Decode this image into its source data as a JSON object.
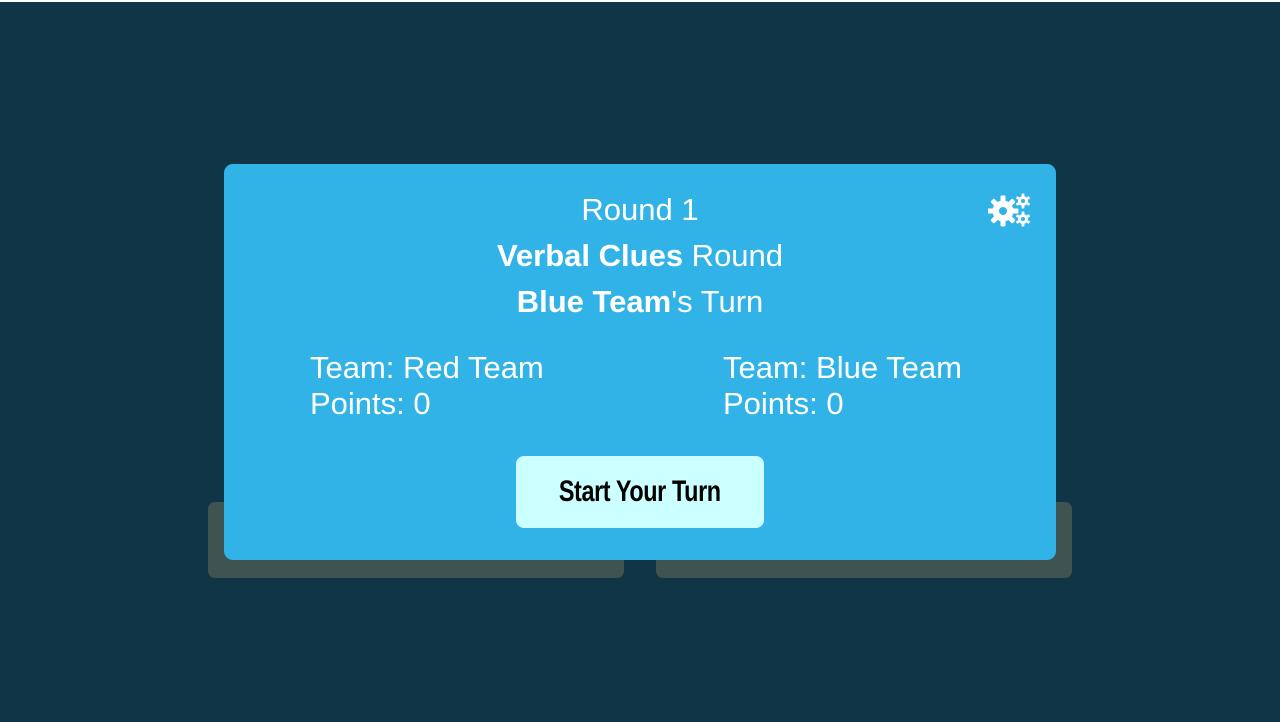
{
  "header": {
    "round": "Round 1",
    "round_type": "Verbal Clues",
    "round_suffix": " Round",
    "current_team": "Blue Team",
    "turn_suffix": "'s Turn"
  },
  "teams": [
    {
      "team_label": "Team: Red Team",
      "points_label": "Points: 0"
    },
    {
      "team_label": "Team: Blue Team",
      "points_label": "Points: 0"
    }
  ],
  "actions": {
    "start_turn": "Start Your Turn"
  },
  "icons": {
    "settings": "gears-icon"
  },
  "colors": {
    "background": "#0f3547",
    "card": "#31b3e7",
    "back_panel": "#3f5451",
    "button": "#ccffff",
    "text": "#ffffff"
  }
}
